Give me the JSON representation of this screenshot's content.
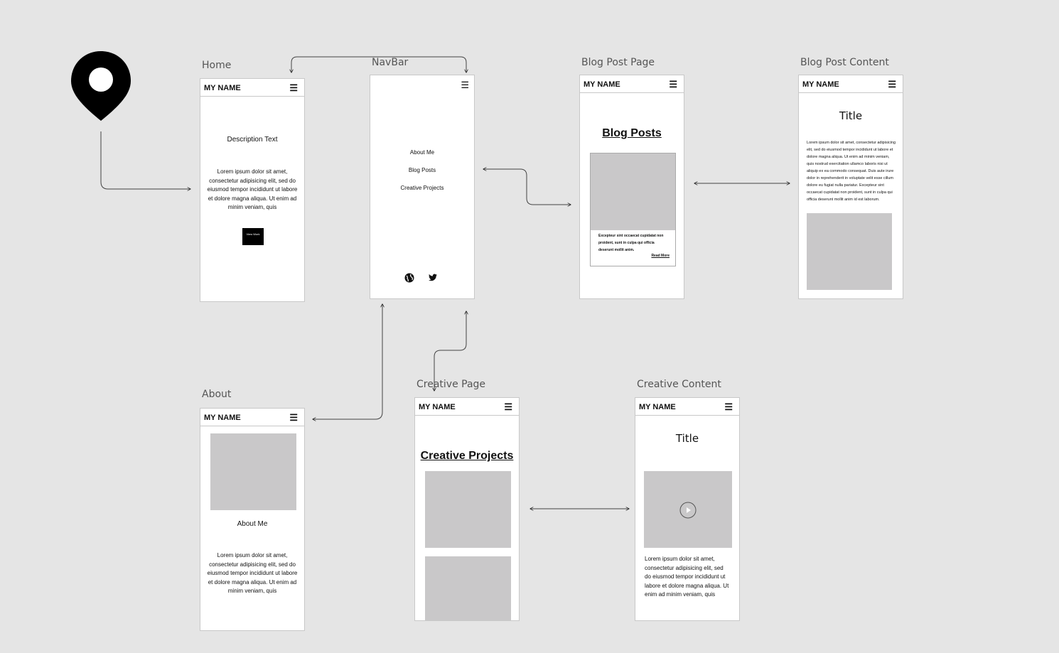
{
  "frames": {
    "home": {
      "label": "Home",
      "app_name": "MY NAME",
      "description_title": "Description Text",
      "description_body": "Lorem ipsum dolor sit amet, consectetur adipisicing elit, sed do eiusmod tempor incididunt ut labore et dolore magna aliqua. Ut enim ad minim veniam, quis",
      "button_label": "View Work"
    },
    "navbar": {
      "label": "NavBar",
      "items": [
        "About Me",
        "Blog Posts",
        "Creative Projects"
      ]
    },
    "blog_post_page": {
      "label": "Blog Post Page",
      "app_name": "MY NAME",
      "heading": "Blog Posts",
      "card_text": "Excepteur sint occaecat cupidatat non proident, sunt in culpa qui officia deserunt mollit anim.",
      "read_more": "Read More"
    },
    "blog_post_content": {
      "label": "Blog Post Content",
      "app_name": "MY NAME",
      "title": "Title",
      "body": "Lorem ipsum dolor sit amet, consectetur adipisicing elit, sed do eiusmod tempor incididunt ut labore et dolore magna aliqua. Ut enim ad minim veniam, quis nostrud exercitation ullamco laboris nisi ut aliquip ex ea commodo consequat. Duis aute irure dolor in reprehenderit in voluptate velit esse cillum dolore eu fugiat nulla pariatur. Excepteur sint occaecat cupidatat non proident, sunt in culpa qui officia deserunt mollit anim id est laborum."
    },
    "about": {
      "label": "About",
      "app_name": "MY NAME",
      "caption": "About Me",
      "body": "Lorem ipsum dolor sit amet, consectetur adipisicing elit, sed do eiusmod tempor incididunt ut labore et dolore magna aliqua. Ut enim ad minim veniam, quis"
    },
    "creative_page": {
      "label": "Creative Page",
      "app_name": "MY NAME",
      "heading": "Creative Projects"
    },
    "creative_content": {
      "label": "Creative Content",
      "app_name": "MY NAME",
      "title": "Title",
      "body": "Lorem ipsum dolor sit amet, consectetur adipisicing elit, sed do eiusmod tempor incididunt ut labore et dolore magna aliqua. Ut enim ad minim veniam, quis"
    }
  },
  "icons": {
    "start": "location-pin-icon",
    "menu": "hamburger-menu-icon",
    "globe": "globe-icon",
    "twitter": "twitter-icon",
    "play": "play-icon"
  }
}
